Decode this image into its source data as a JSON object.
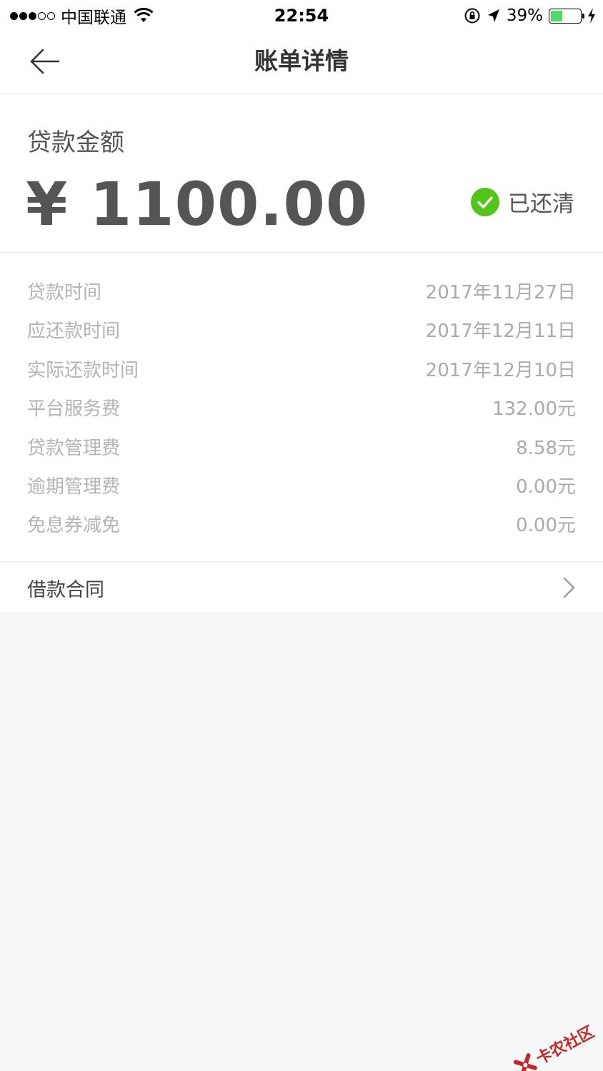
{
  "status_bar": {
    "carrier": "中国联通",
    "time": "22:54",
    "battery_percent": "39%",
    "battery_level": 0.39
  },
  "nav": {
    "title": "账单详情"
  },
  "loan": {
    "amount_label": "贷款金额",
    "amount": "¥ 1100.00",
    "status": "已还清",
    "status_color": "#52c41a"
  },
  "details": [
    {
      "label": "贷款时间",
      "value": "2017年11月27日"
    },
    {
      "label": "应还款时间",
      "value": "2017年12月11日"
    },
    {
      "label": "实际还款时间",
      "value": "2017年12月10日"
    },
    {
      "label": "平台服务费",
      "value": "132.00元"
    },
    {
      "label": "贷款管理费",
      "value": "8.58元"
    },
    {
      "label": "逾期管理费",
      "value": "0.00元"
    },
    {
      "label": "免息券减免",
      "value": "0.00元"
    }
  ],
  "contract": {
    "label": "借款合同"
  },
  "watermark": {
    "text": "卡农社区"
  }
}
